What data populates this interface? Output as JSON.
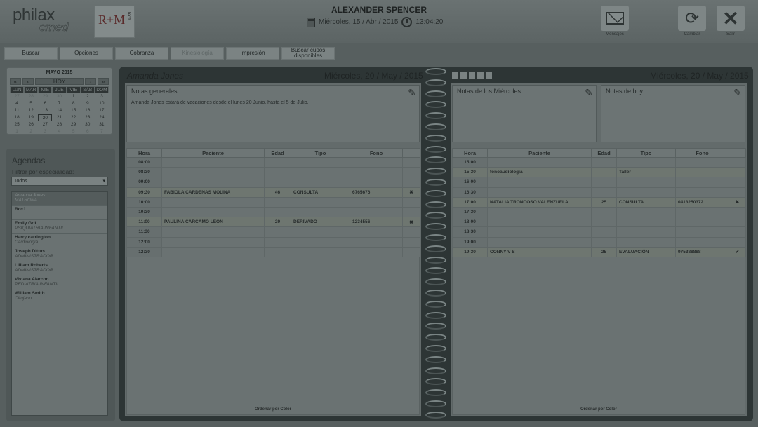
{
  "header": {
    "logo_main": "philax",
    "logo_sub": "cmed",
    "logo_partner": "R+M",
    "logo_partner_sub": "tech",
    "user_name": "ALEXANDER SPENCER",
    "date": "Miércoles, 15 / Abr / 2015",
    "time": "13:04:20",
    "buttons": {
      "mensajes": "Mensajes",
      "cambiar": "Cambiar",
      "salir": "Salir"
    }
  },
  "toolbar": {
    "buscar": "Buscar",
    "opciones": "Opciones",
    "cobranza": "Cobranza",
    "kinesiologia": "Kinesiología",
    "impresion": "Impresión",
    "buscar_cupos": "Buscar cupos disponibles"
  },
  "minical": {
    "title": "MAYO 2015",
    "today": "HOY",
    "nav": {
      "prev_year": "«",
      "prev": "‹",
      "next": "›",
      "next_year": "»"
    },
    "days": [
      "LUN",
      "MAR",
      "MIÉ",
      "JUE",
      "VIE",
      "SÁB",
      "DOM"
    ],
    "weeks": [
      [
        "27",
        "28",
        "29",
        "30",
        "1",
        "2",
        "3"
      ],
      [
        "4",
        "5",
        "6",
        "7",
        "8",
        "9",
        "10"
      ],
      [
        "11",
        "12",
        "13",
        "14",
        "15",
        "16",
        "17"
      ],
      [
        "18",
        "19",
        "20",
        "21",
        "22",
        "23",
        "24"
      ],
      [
        "25",
        "26",
        "27",
        "28",
        "29",
        "30",
        "31"
      ],
      [
        "1",
        "2",
        "3",
        "4",
        "5",
        "6",
        "7"
      ]
    ]
  },
  "agendas": {
    "title": "Agendas",
    "filter_label": "Filtrar por especialidad:",
    "filter_value": "Todos",
    "items": [
      {
        "name": "Amanda Jones",
        "role": "MATRONA"
      },
      {
        "name": "Box1",
        "role": ""
      },
      {
        "name": "Emily Grif",
        "role": "PSIQUIATRIA INFANTIL"
      },
      {
        "name": "Harry carrington",
        "role": "Cardiología"
      },
      {
        "name": "Joseph Dittus",
        "role": "ADMINISTRADOR"
      },
      {
        "name": "Lilliam Roberts",
        "role": "ADMINISTRADOR"
      },
      {
        "name": "Viviana Alarcon",
        "role": "PEDIATRIA INFANTIL"
      },
      {
        "name": "William Smith",
        "role": "Cirujano"
      }
    ]
  },
  "left_page": {
    "doctor": "Amanda Jones",
    "date": "Miércoles, 20 / May / 2015",
    "notes_title": "Notas generales",
    "notes_text": "Amanda Jones estará de vacaciones desde el lunes 20 Junio, hasta el 5 de Julio.",
    "columns": [
      "Hora",
      "Paciente",
      "Edad",
      "Tipo",
      "Fono"
    ],
    "rows": [
      {
        "hora": "08:00",
        "paciente": "",
        "edad": "",
        "tipo": "",
        "fono": "",
        "mark": ""
      },
      {
        "hora": "08:30",
        "paciente": "",
        "edad": "",
        "tipo": "",
        "fono": "",
        "mark": ""
      },
      {
        "hora": "09:00",
        "paciente": "",
        "edad": "",
        "tipo": "",
        "fono": "",
        "mark": ""
      },
      {
        "hora": "09:30",
        "paciente": "FABIOLA CARDENAS MOLINA",
        "edad": "46",
        "tipo": "CONSULTA",
        "fono": "6765676",
        "mark": "✖"
      },
      {
        "hora": "10:00",
        "paciente": "",
        "edad": "",
        "tipo": "",
        "fono": "",
        "mark": ""
      },
      {
        "hora": "10:30",
        "paciente": "",
        "edad": "",
        "tipo": "",
        "fono": "",
        "mark": ""
      },
      {
        "hora": "11:00",
        "paciente": "PAULINA CARCAMO LEON",
        "edad": "29",
        "tipo": "DERIVADO",
        "fono": "1234556",
        "mark": "✖"
      },
      {
        "hora": "11:30",
        "paciente": "",
        "edad": "",
        "tipo": "",
        "fono": "",
        "mark": ""
      },
      {
        "hora": "12:00",
        "paciente": "",
        "edad": "",
        "tipo": "",
        "fono": "",
        "mark": ""
      },
      {
        "hora": "12:30",
        "paciente": "",
        "edad": "",
        "tipo": "",
        "fono": "",
        "mark": ""
      }
    ],
    "order_label": "Ordenar por Color"
  },
  "right_page": {
    "date": "Miércoles, 20 / May / 2015",
    "notes_weekday_title": "Notas de los Miércoles",
    "notes_today_title": "Notas de hoy",
    "columns": [
      "Hora",
      "Paciente",
      "Edad",
      "Tipo",
      "Fono"
    ],
    "rows": [
      {
        "hora": "15:00",
        "paciente": "",
        "edad": "",
        "tipo": "",
        "fono": "",
        "mark": ""
      },
      {
        "hora": "15:30",
        "paciente": "fonoaudiologia",
        "edad": "",
        "tipo": "Taller",
        "fono": "",
        "mark": ""
      },
      {
        "hora": "16:00",
        "paciente": "",
        "edad": "",
        "tipo": "",
        "fono": "",
        "mark": ""
      },
      {
        "hora": "16:30",
        "paciente": "",
        "edad": "",
        "tipo": "",
        "fono": "",
        "mark": ""
      },
      {
        "hora": "17:00",
        "paciente": "NATALIA TRONCOSO VALENZUELA",
        "edad": "25",
        "tipo": "CONSULTA",
        "fono": "0413250372",
        "mark": "✖"
      },
      {
        "hora": "17:30",
        "paciente": "",
        "edad": "",
        "tipo": "",
        "fono": "",
        "mark": ""
      },
      {
        "hora": "18:00",
        "paciente": "",
        "edad": "",
        "tipo": "",
        "fono": "",
        "mark": ""
      },
      {
        "hora": "18:30",
        "paciente": "",
        "edad": "",
        "tipo": "",
        "fono": "",
        "mark": ""
      },
      {
        "hora": "19:00",
        "paciente": "",
        "edad": "",
        "tipo": "",
        "fono": "",
        "mark": ""
      },
      {
        "hora": "19:30",
        "paciente": "CONNY V S",
        "edad": "25",
        "tipo": "EVALUACIÓN",
        "fono": "975388888",
        "mark": "✔"
      }
    ],
    "order_label": "Ordenar por Color"
  }
}
